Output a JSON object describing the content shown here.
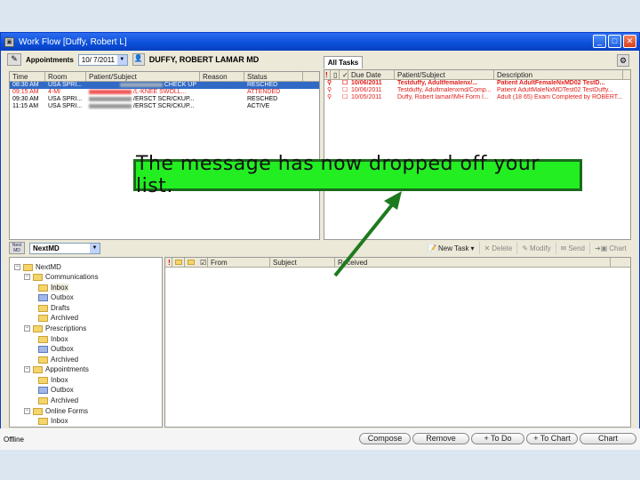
{
  "window": {
    "title": "Work Flow [Duffy, Robert L]",
    "min": "_",
    "max": "□",
    "close": "✕"
  },
  "appointments": {
    "label": "Appointments",
    "date": "10/ 7/2011",
    "provider": "DUFFY, ROBERT LAMAR MD",
    "columns": [
      "Time",
      "Room",
      "Patient/Subject",
      "Reason",
      "Status"
    ],
    "rows": [
      {
        "time": "08:30 AM",
        "room": "USA SPRI...",
        "subject": "CHECK UP",
        "reason": "",
        "status": "RESCHED",
        "style": "selected"
      },
      {
        "time": "09:15 AM",
        "room": "4-MI",
        "subject": "/L-KNEE SWOLL...",
        "reason": "",
        "status": "ATTENDED",
        "style": "red"
      },
      {
        "time": "09:30 AM",
        "room": "USA SPRI...",
        "subject": "/ERSCT SCR/CKUP...",
        "reason": "",
        "status": "RESCHED",
        "style": "normal"
      },
      {
        "time": "11:15 AM",
        "room": "USA SPRI...",
        "subject": "/ERSCT SCR/CKUP...",
        "reason": "",
        "status": "ACTIVE",
        "style": "normal"
      }
    ]
  },
  "tasks": {
    "tab": "All Tasks",
    "columns": [
      "!",
      "",
      "✓",
      "Due Date",
      "Patient/Subject",
      "Description"
    ],
    "rows": [
      {
        "due": "10/06/2011",
        "subject": "Testduffy, Adultfemalenx/...",
        "description": "Patient AdultFemaleNxMD02 TestD...",
        "bold": true
      },
      {
        "due": "10/06/2011",
        "subject": "Testduffy, Adultmalenxmd/Comp...",
        "description": "Patient AdultMaleNxMDTest02 TestDuffy...",
        "bold": false
      },
      {
        "due": "10/05/2011",
        "subject": "Duffy, Robert lamar/IMH Form I...",
        "description": "Adult (18 65) Exam Completed by ROBERT...",
        "bold": false
      }
    ]
  },
  "nextmd": {
    "logo": "Next MD",
    "dropdown": "NextMD",
    "tree": [
      {
        "label": "NextMD",
        "level": 0
      },
      {
        "label": "Communications",
        "level": 1
      },
      {
        "label": "Inbox",
        "level": 2
      },
      {
        "label": "Outbox",
        "level": 2
      },
      {
        "label": "Drafts",
        "level": 2
      },
      {
        "label": "Archived",
        "level": 2
      },
      {
        "label": "Prescriptions",
        "level": 1
      },
      {
        "label": "Inbox",
        "level": 2
      },
      {
        "label": "Outbox",
        "level": 2
      },
      {
        "label": "Archived",
        "level": 2
      },
      {
        "label": "Appointments",
        "level": 1
      },
      {
        "label": "Inbox",
        "level": 2
      },
      {
        "label": "Outbox",
        "level": 2
      },
      {
        "label": "Archived",
        "level": 2
      },
      {
        "label": "Online Forms",
        "level": 1
      },
      {
        "label": "Inbox",
        "level": 2
      }
    ],
    "toolbar": {
      "new_task": "New Task",
      "delete": "Delete",
      "modify": "Modify",
      "send": "Send",
      "chart": "Chart"
    },
    "columns": [
      "!",
      "",
      "",
      "",
      "From",
      "Subject",
      "Received"
    ]
  },
  "status": "Offline",
  "buttons": [
    "Compose",
    "Remove",
    "+ To Do",
    "+ To Chart",
    "Chart"
  ],
  "callout": "The message has now dropped off your list."
}
